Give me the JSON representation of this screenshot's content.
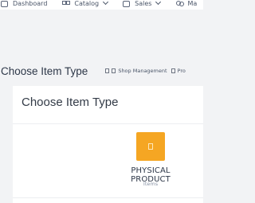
{
  "nav": {
    "items": [
      {
        "label": "Dashboard",
        "icon": "dashboard-icon"
      },
      {
        "label": "Catalog",
        "icon": "grid-icon"
      },
      {
        "label": "Sales",
        "icon": "sales-icon"
      },
      {
        "label": "Ma",
        "icon": "people-icon"
      }
    ]
  },
  "page": {
    "title": "Choose Item Type",
    "breadcrumb": [
      "Shop Management",
      "Pro"
    ]
  },
  "card": {
    "title": "Choose Item Type",
    "option": {
      "title": "PHYSICAL PRODUCT",
      "subtitle": "Items",
      "icon": "box-icon",
      "color": "#f5a623"
    }
  },
  "colors": {
    "background": "#f2f3f5",
    "accent": "#f5a623"
  }
}
